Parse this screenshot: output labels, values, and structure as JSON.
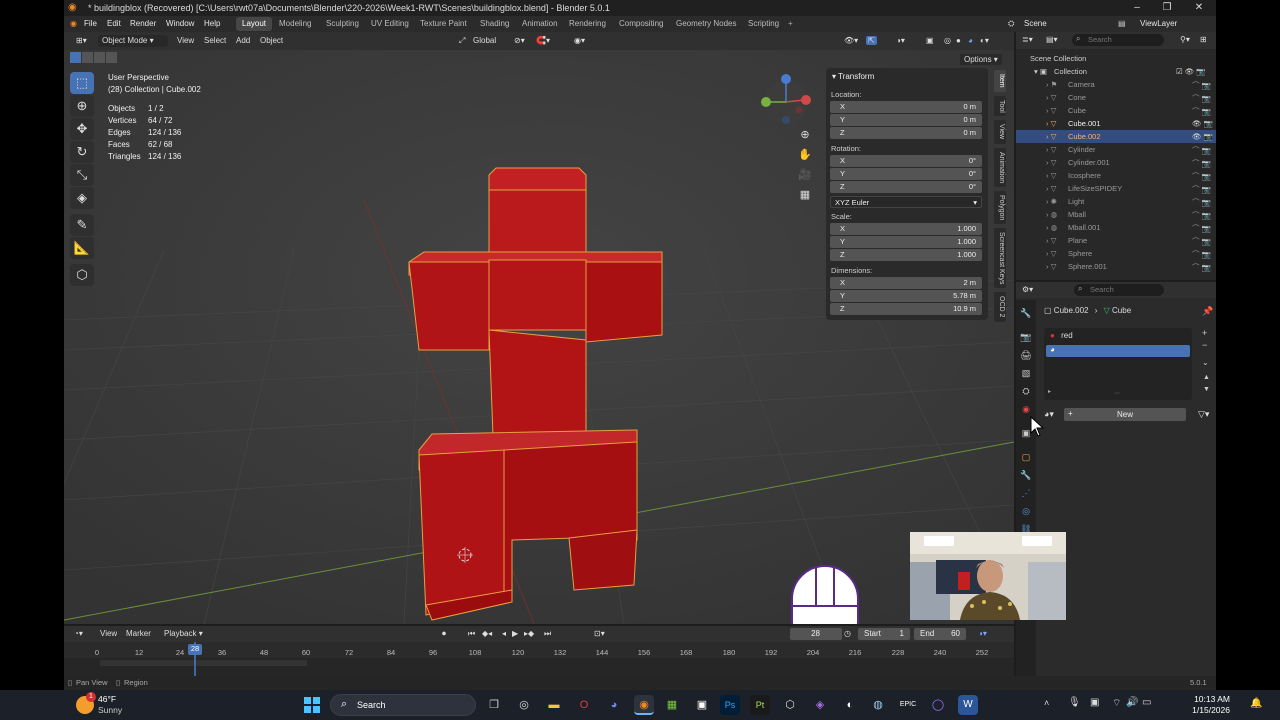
{
  "window": {
    "title": "* buildingblox (Recovered) [C:\\Users\\rwt07a\\Documents\\Blender\\220-2026\\Week1-RWT\\Scenes\\buildingblox.blend] - Blender 5.0.1"
  },
  "topbar": {
    "menus": [
      "File",
      "Edit",
      "Render",
      "Window",
      "Help"
    ],
    "workspaces": [
      "Layout",
      "Modeling",
      "Sculpting",
      "UV Editing",
      "Texture Paint",
      "Shading",
      "Animation",
      "Rendering",
      "Compositing",
      "Geometry Nodes",
      "Scripting"
    ],
    "active_workspace": "Layout",
    "scene": "Scene",
    "view_layer": "ViewLayer"
  },
  "viewport_header": {
    "mode": "Object Mode",
    "menus": [
      "View",
      "Select",
      "Add",
      "Object"
    ],
    "orientation": "Global",
    "options": "Options"
  },
  "viewport": {
    "perspective": "User Perspective",
    "context": "(28) Collection | Cube.002",
    "stats": [
      {
        "label": "Objects",
        "value": "1 / 2"
      },
      {
        "label": "Vertices",
        "value": "64 / 72"
      },
      {
        "label": "Edges",
        "value": "124 / 136"
      },
      {
        "label": "Faces",
        "value": "62 / 68"
      },
      {
        "label": "Triangles",
        "value": "124 / 136"
      }
    ],
    "object_color": "#b8181a"
  },
  "npanel": {
    "title": "Transform",
    "location_label": "Location:",
    "location": [
      {
        "axis": "X",
        "value": "0 m"
      },
      {
        "axis": "Y",
        "value": "0 m"
      },
      {
        "axis": "Z",
        "value": "0 m"
      }
    ],
    "rotation_label": "Rotation:",
    "rotation": [
      {
        "axis": "X",
        "value": "0°"
      },
      {
        "axis": "Y",
        "value": "0°"
      },
      {
        "axis": "Z",
        "value": "0°"
      }
    ],
    "rotation_mode": "XYZ Euler",
    "scale_label": "Scale:",
    "scale": [
      {
        "axis": "X",
        "value": "1.000"
      },
      {
        "axis": "Y",
        "value": "1.000"
      },
      {
        "axis": "Z",
        "value": "1.000"
      }
    ],
    "dimensions_label": "Dimensions:",
    "dimensions": [
      {
        "axis": "X",
        "value": "2 m"
      },
      {
        "axis": "Y",
        "value": "5.78 m"
      },
      {
        "axis": "Z",
        "value": "10.9 m"
      }
    ],
    "side_tabs": [
      "Item",
      "Tool",
      "View",
      "Animation",
      "Polygon",
      "Screencast Keys",
      "OCD 2"
    ]
  },
  "outliner": {
    "search_placeholder": "Search",
    "scene_collection": "Scene Collection",
    "collection": "Collection",
    "items": [
      "Camera",
      "Cone",
      "Cube",
      "Cube.001",
      "Cube.002",
      "Cylinder",
      "Cylinder.001",
      "Icosphere",
      "LifeSizeSPIDEY",
      "Light",
      "Mball",
      "Mball.001",
      "Plane",
      "Sphere",
      "Sphere.001"
    ],
    "selected": "Cube.002"
  },
  "properties": {
    "search_placeholder": "Search",
    "breadcrumb_object": "Cube.002",
    "breadcrumb_mesh": "Cube",
    "material_slots": [
      "red",
      ""
    ],
    "new_button": "New"
  },
  "timeline": {
    "menus": [
      "View",
      "Marker",
      "Playback"
    ],
    "current_frame": "28",
    "start_label": "Start",
    "start": "1",
    "end_label": "End",
    "end": "60",
    "ruler": [
      "0",
      "12",
      "24",
      "36",
      "48",
      "60",
      "72",
      "84",
      "96",
      "108",
      "120",
      "132",
      "144",
      "156",
      "168",
      "180",
      "192",
      "204",
      "216",
      "228",
      "240",
      "252"
    ]
  },
  "statusbar": {
    "left1": "Pan View",
    "left2": "Region",
    "version": "5.0.1"
  },
  "taskbar": {
    "weather_temp": "46°F",
    "weather_desc": "Sunny",
    "weather_badge": "1",
    "search_placeholder": "Search",
    "time": "10:13 AM",
    "date": "1/15/2026"
  }
}
